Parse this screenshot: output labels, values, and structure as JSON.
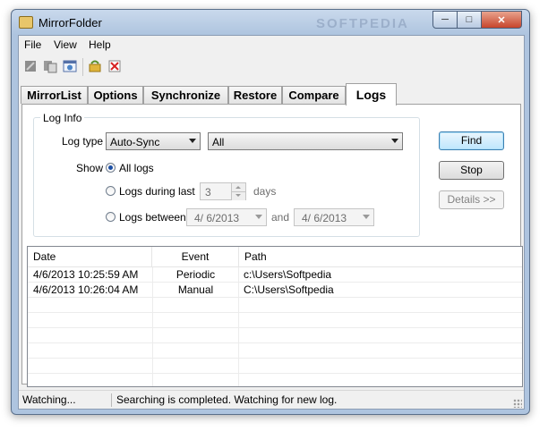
{
  "window": {
    "title": "MirrorFolder",
    "watermark": "SOFTPEDIA"
  },
  "menu": [
    "File",
    "View",
    "Help"
  ],
  "tabs": [
    {
      "label": "MirrorList",
      "active": false
    },
    {
      "label": "Options",
      "active": false
    },
    {
      "label": "Synchronize",
      "active": false
    },
    {
      "label": "Restore",
      "active": false
    },
    {
      "label": "Compare",
      "active": false
    },
    {
      "label": "Logs",
      "active": true
    }
  ],
  "loginfo": {
    "title": "Log Info",
    "log_type_label": "Log type",
    "log_type_value": "Auto-Sync",
    "filter_value": "All",
    "show_label": "Show",
    "radio_all": "All logs",
    "radio_last": "Logs during last",
    "days_value": "3",
    "days_label": "days",
    "radio_between": "Logs between",
    "date_from": "4/ 6/2013",
    "and_label": "and",
    "date_to": "4/ 6/2013",
    "selected": "all"
  },
  "buttons": {
    "find": "Find",
    "stop": "Stop",
    "details": "Details >>"
  },
  "table": {
    "headers": [
      "Date",
      "Event",
      "Path"
    ],
    "rows": [
      {
        "date": "4/6/2013 10:25:59 AM",
        "event": "Periodic",
        "path": "c:\\Users\\Softpedia"
      },
      {
        "date": "4/6/2013 10:26:04 AM",
        "event": "Manual",
        "path": "C:\\Users\\Softpedia"
      }
    ]
  },
  "status": {
    "left": "Watching...",
    "right": "Searching is completed. Watching for new log."
  },
  "colors": {
    "title_bar": "#aec4df",
    "accent": "#3c7fb1",
    "close": "#c7452b"
  }
}
